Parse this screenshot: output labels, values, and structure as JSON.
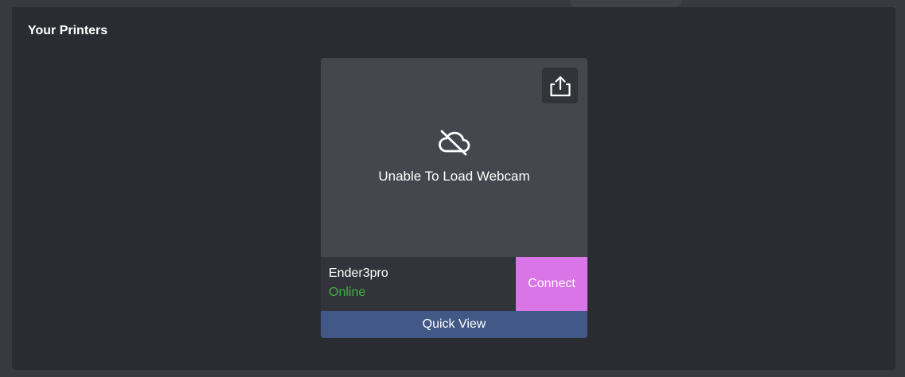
{
  "colors": {
    "page_background": "#393a40",
    "panel_background": "#2b2c31",
    "webcam_background": "#45474f",
    "info_background": "#33343b",
    "connect_accent": "#d975e6",
    "quick_view_accent": "#425886",
    "status_online": "#3db43d"
  },
  "panel": {
    "title": "Your Printers"
  },
  "printer_card": {
    "share_icon": "share-upload-icon",
    "webcam": {
      "icon": "cloud-off-icon",
      "message": "Unable To Load Webcam"
    },
    "name": "Ender3pro",
    "status": "Online",
    "connect_label": "Connect",
    "quick_view_label": "Quick View"
  }
}
